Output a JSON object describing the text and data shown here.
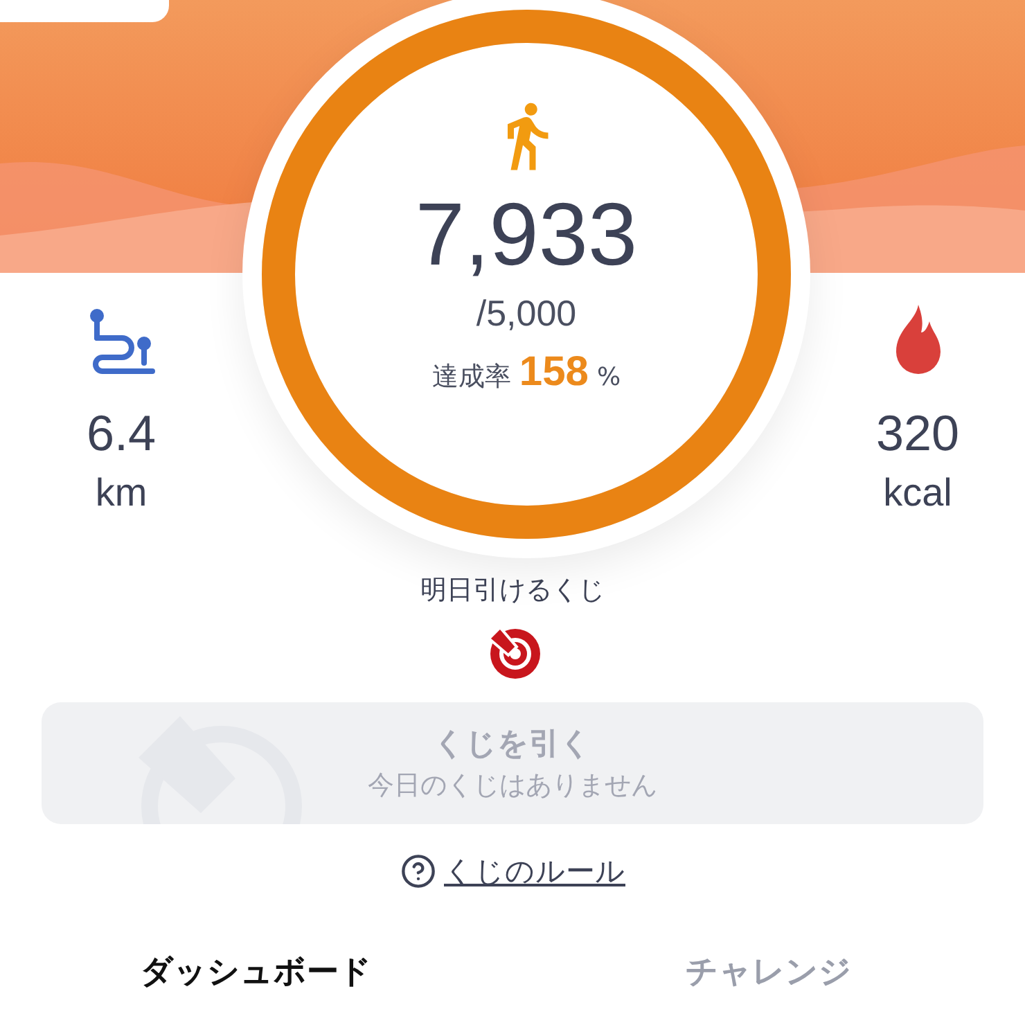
{
  "steps": {
    "count": "7,933",
    "goal": "/5,000",
    "rate_label": "達成率",
    "rate_value": "158",
    "rate_unit": "%",
    "level": 1
  },
  "distance": {
    "value": "6.4",
    "unit": "km"
  },
  "calories": {
    "value": "320",
    "unit": "kcal"
  },
  "lottery": {
    "label": "明日引けるくじ",
    "button": {
      "title": "くじを引く",
      "subtitle": "今日のくじはありません",
      "disabled": true
    },
    "rules_link": "くじのルール"
  },
  "tabs": [
    {
      "label": "ダッシュボード",
      "selected": true
    },
    {
      "label": "チャレンジ",
      "selected": false
    }
  ]
}
